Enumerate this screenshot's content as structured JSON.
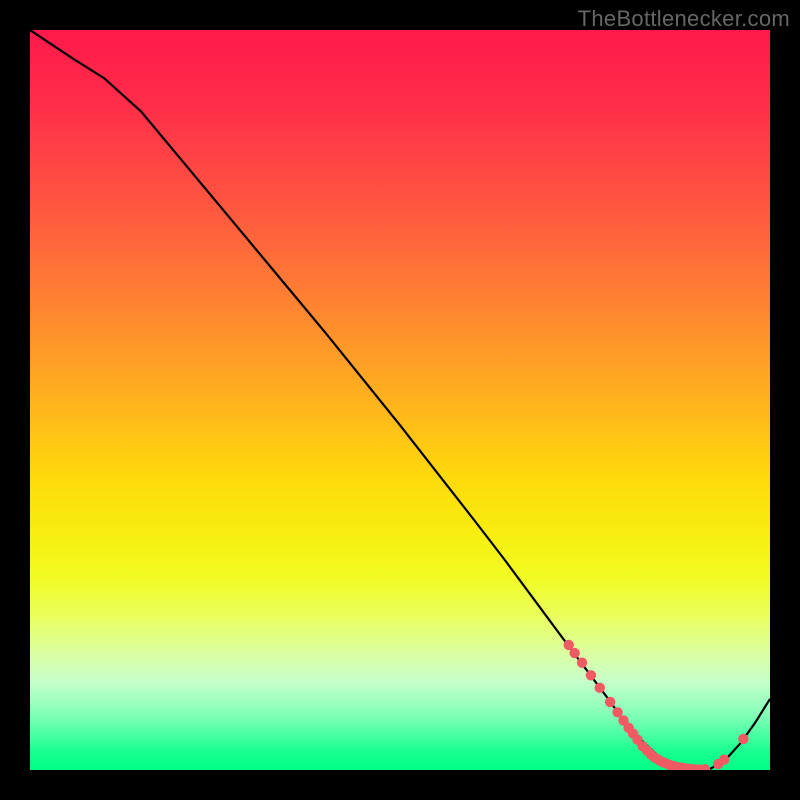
{
  "watermark": "TheBottlenecker.com",
  "chart_data": {
    "type": "line",
    "title": "",
    "xlabel": "",
    "ylabel": "",
    "xlim": [
      0,
      100
    ],
    "ylim": [
      0,
      100
    ],
    "grid": false,
    "note": "Values are approximate percentages inferred from pixel positions; no axis ticks are printed on the chart.",
    "series": [
      {
        "name": "bottleneck-curve",
        "x": [
          0,
          3,
          6,
          10,
          15,
          20,
          25,
          30,
          35,
          40,
          45,
          50,
          55,
          60,
          64,
          68,
          72,
          75,
          78,
          80,
          82,
          85,
          88,
          90,
          92,
          94,
          96,
          98,
          100
        ],
        "y": [
          100,
          98,
          96,
          93.5,
          89,
          83,
          77,
          71,
          65,
          59,
          52.8,
          46.6,
          40.2,
          33.8,
          28.6,
          23.2,
          17.8,
          13.8,
          9.8,
          7.0,
          4.6,
          1.8,
          0.4,
          0.05,
          0.2,
          1.4,
          3.6,
          6.4,
          9.6
        ]
      }
    ],
    "points": [
      {
        "x": 72.8,
        "y": 16.9
      },
      {
        "x": 73.6,
        "y": 15.8
      },
      {
        "x": 74.6,
        "y": 14.5
      },
      {
        "x": 75.8,
        "y": 12.8
      },
      {
        "x": 77.0,
        "y": 11.1
      },
      {
        "x": 78.4,
        "y": 9.2
      },
      {
        "x": 79.4,
        "y": 7.8
      },
      {
        "x": 80.2,
        "y": 6.7
      },
      {
        "x": 80.9,
        "y": 5.7
      },
      {
        "x": 81.5,
        "y": 4.9
      },
      {
        "x": 82.1,
        "y": 4.1
      },
      {
        "x": 82.8,
        "y": 3.2
      },
      {
        "x": 83.4,
        "y": 2.6
      },
      {
        "x": 83.9,
        "y": 2.1
      },
      {
        "x": 84.4,
        "y": 1.7
      },
      {
        "x": 84.9,
        "y": 1.4
      },
      {
        "x": 85.4,
        "y": 1.1
      },
      {
        "x": 85.9,
        "y": 0.9
      },
      {
        "x": 86.4,
        "y": 0.7
      },
      {
        "x": 86.9,
        "y": 0.55
      },
      {
        "x": 87.4,
        "y": 0.42
      },
      {
        "x": 87.9,
        "y": 0.32
      },
      {
        "x": 88.4,
        "y": 0.24
      },
      {
        "x": 88.9,
        "y": 0.18
      },
      {
        "x": 89.4,
        "y": 0.13
      },
      {
        "x": 89.9,
        "y": 0.08
      },
      {
        "x": 90.4,
        "y": 0.06
      },
      {
        "x": 91.2,
        "y": 0.1
      },
      {
        "x": 93.0,
        "y": 0.8
      },
      {
        "x": 93.8,
        "y": 1.4
      },
      {
        "x": 96.4,
        "y": 4.2
      }
    ],
    "colors": {
      "curve": "#000000",
      "points": "#ef5a63",
      "gradient_top": "#ff1a4b",
      "gradient_bottom": "#00ff85"
    }
  }
}
